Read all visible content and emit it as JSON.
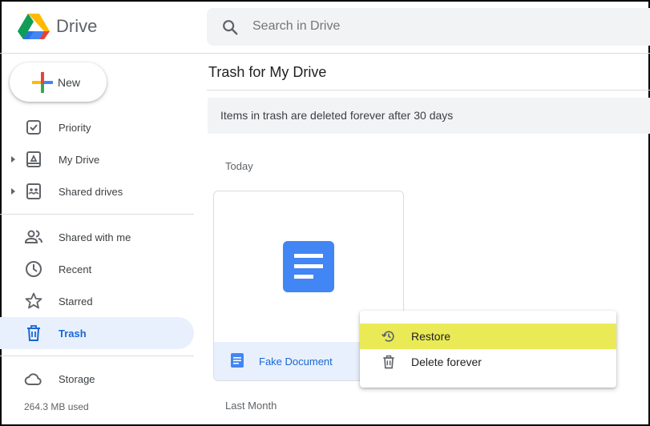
{
  "app": {
    "name": "Drive"
  },
  "search": {
    "placeholder": "Search in Drive"
  },
  "new_button": {
    "label": "New"
  },
  "sidebar": {
    "items": [
      {
        "label": "Priority",
        "icon": "priority-icon"
      },
      {
        "label": "My Drive",
        "icon": "my-drive-icon",
        "expandable": true
      },
      {
        "label": "Shared drives",
        "icon": "shared-drives-icon",
        "expandable": true
      },
      {
        "label": "Shared with me",
        "icon": "people-icon"
      },
      {
        "label": "Recent",
        "icon": "clock-icon"
      },
      {
        "label": "Starred",
        "icon": "star-icon"
      },
      {
        "label": "Trash",
        "icon": "trash-icon",
        "active": true
      },
      {
        "label": "Storage",
        "icon": "cloud-icon"
      }
    ],
    "storage_used": "264.3 MB used"
  },
  "main": {
    "title": "Trash for My Drive",
    "banner": "Items in trash are deleted forever after 30 days",
    "sections": [
      {
        "label": "Today"
      },
      {
        "label": "Last Month"
      }
    ],
    "files": [
      {
        "name": "Fake Document",
        "type": "google-doc"
      }
    ]
  },
  "context_menu": {
    "items": [
      {
        "label": "Restore",
        "icon": "restore-icon",
        "highlighted": true
      },
      {
        "label": "Delete forever",
        "icon": "trash-icon"
      }
    ]
  },
  "colors": {
    "accent": "#1967d2",
    "active_bg": "#e8f0fe",
    "highlight": "#eaea56",
    "doc_blue": "#4285f4"
  }
}
